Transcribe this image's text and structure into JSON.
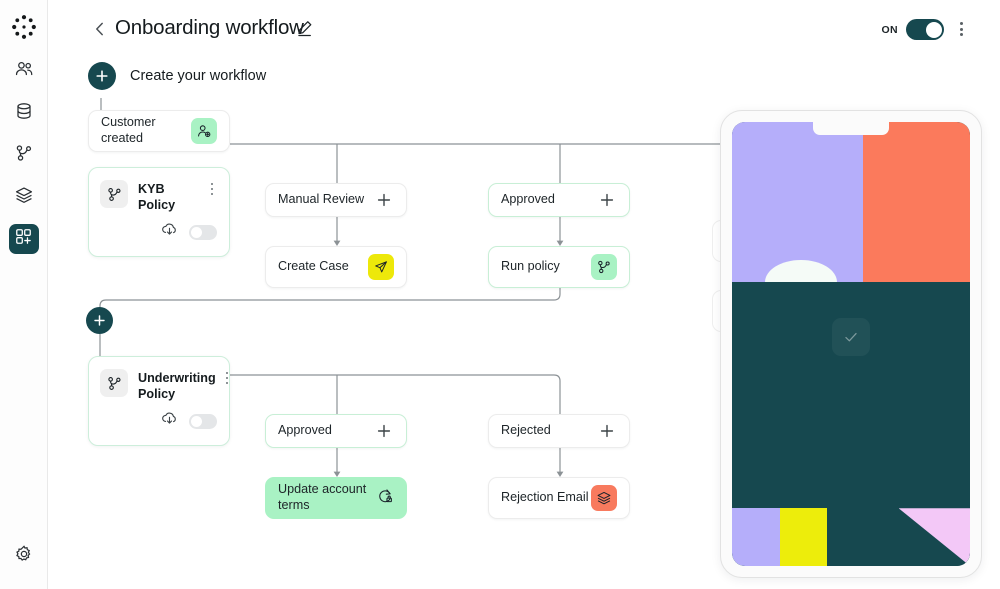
{
  "sidebar": {
    "items": [
      {
        "name": "logo",
        "icon": "app-logo-icon",
        "active": false
      },
      {
        "name": "customers",
        "icon": "users-icon",
        "active": false
      },
      {
        "name": "data",
        "icon": "database-icon",
        "active": false
      },
      {
        "name": "policies",
        "icon": "policy-branch-icon",
        "active": false
      },
      {
        "name": "layers",
        "icon": "layers-icon",
        "active": false
      },
      {
        "name": "workflows",
        "icon": "grid-plus-icon",
        "active": true
      }
    ],
    "bottom": {
      "name": "settings",
      "icon": "gear-icon"
    }
  },
  "header": {
    "back_icon": "chevron-left-icon",
    "title": "Onboarding workflow",
    "edit_icon": "pencil-icon",
    "toggle_label": "ON",
    "toggle_on": true,
    "menu_icon": "kebab-menu-icon"
  },
  "create_row": {
    "plus_icon": "plus-icon",
    "label": "Create your workflow"
  },
  "nodes": {
    "customer_created": {
      "label": "Customer created",
      "icon": "user-add-icon",
      "badge_color": "#a9f2c4"
    },
    "kyb_policy": {
      "label": "KYB Policy",
      "icon": "policy-branch-icon",
      "download_icon": "cloud-download-icon",
      "toggle_on": false
    },
    "manual_review": {
      "label": "Manual Review",
      "icon": "plus-icon"
    },
    "create_case": {
      "label": "Create Case",
      "icon": "send-icon",
      "badge_color": "#ede80a"
    },
    "approved_top": {
      "label": "Approved",
      "icon": "plus-icon"
    },
    "run_policy": {
      "label": "Run policy",
      "icon": "policy-branch-icon",
      "badge_color": "#a9f2c4"
    },
    "underwriting_policy": {
      "label": "Underwriting Policy",
      "icon": "policy-branch-icon",
      "download_icon": "cloud-download-icon",
      "toggle_on": false
    },
    "approved_bottom": {
      "label": "Approved",
      "icon": "plus-icon"
    },
    "update_terms": {
      "label": "Update account terms",
      "icon": "refresh-lock-icon"
    },
    "rejected": {
      "label": "Rejected",
      "icon": "plus-icon"
    },
    "rejection_email": {
      "label": "Rejection Email",
      "icon": "layers-icon",
      "badge_color": "#f87a5e"
    }
  },
  "canvas_add_button": {
    "icon": "plus-icon"
  },
  "tablet": {
    "check_icon": "check-icon",
    "colors": {
      "purple": "#b5aefa",
      "orange": "#fb7a5c",
      "teal": "#16484f",
      "yellow": "#eded0b",
      "pink": "#f3c8f7"
    }
  },
  "theme": {
    "accent_dark": "#16484f",
    "mint": "#a9f2c4",
    "mint_border": "#c8efd6",
    "yellow": "#ede80a",
    "orange": "#f87a5e",
    "edge": "#8c9296"
  }
}
